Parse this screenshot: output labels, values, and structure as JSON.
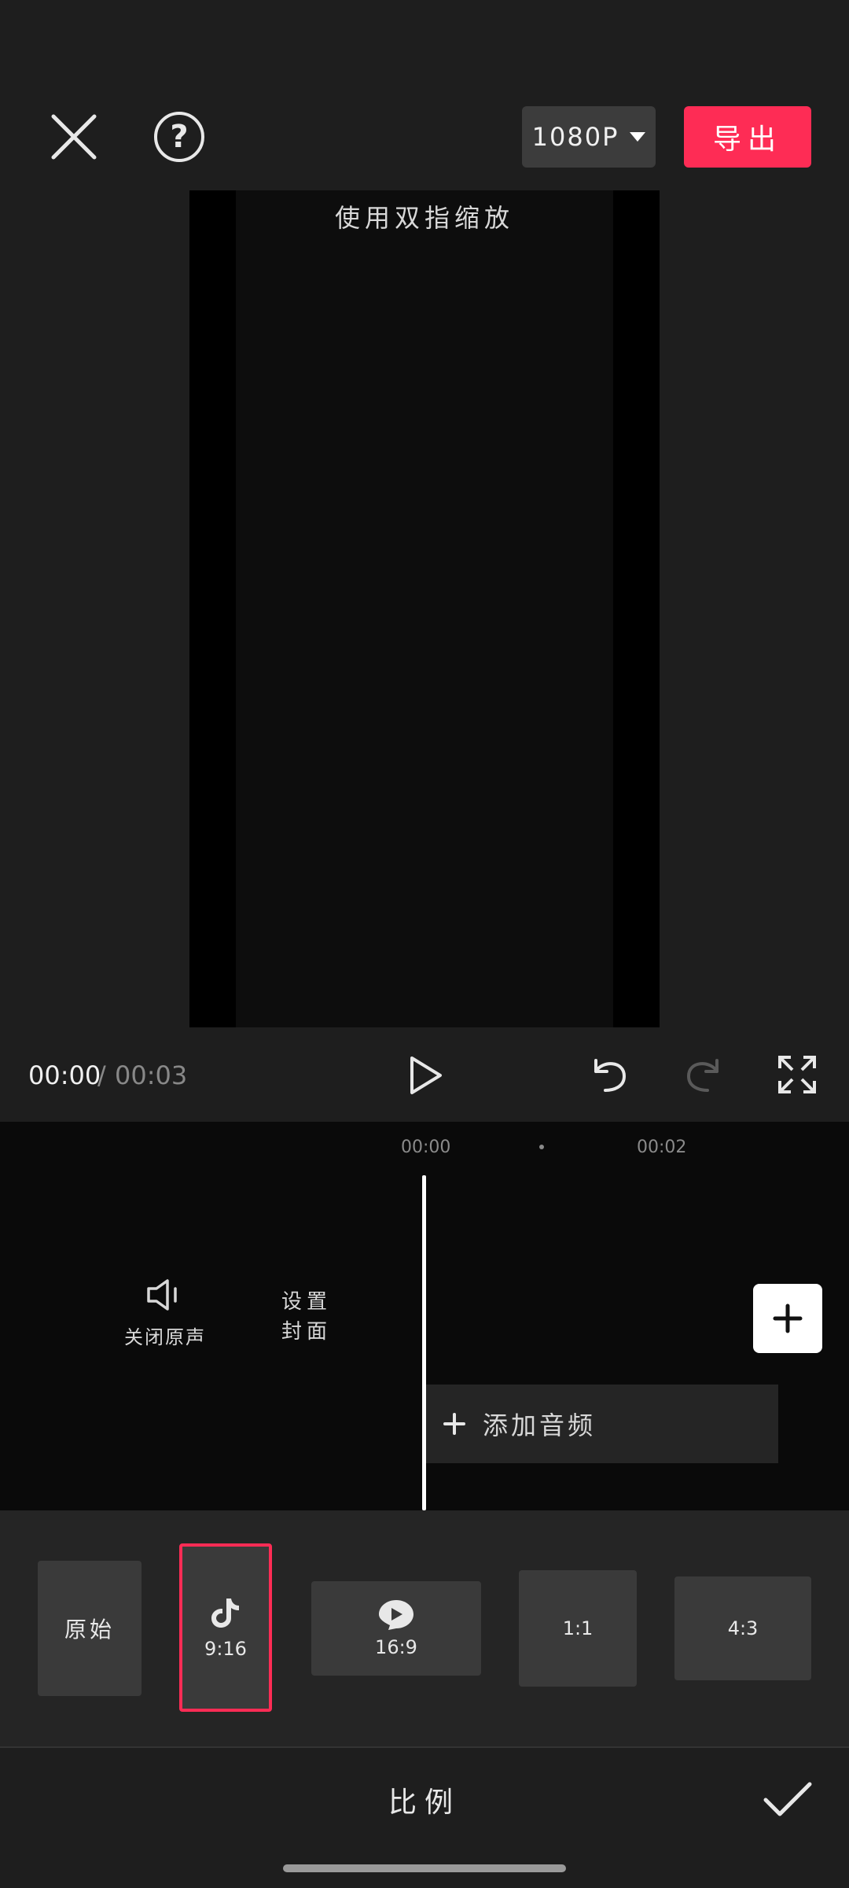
{
  "top_bar": {
    "resolution": "1080P",
    "export_label": "导出",
    "accent_color": "#fe2c55"
  },
  "preview": {
    "hint": "使用双指缩放"
  },
  "playback": {
    "current_time": "00:00",
    "separator": "/",
    "total_time": "00:03"
  },
  "timeline": {
    "ticks": [
      "00:00",
      "00:02"
    ],
    "mute_label": "关闭原声",
    "cover_label_line1": "设置",
    "cover_label_line2": "封面",
    "add_audio_label": "添加音频"
  },
  "ratio_options": [
    {
      "label": "原始"
    },
    {
      "label": "9:16",
      "icon": "tiktok-icon",
      "selected": true
    },
    {
      "label": "16:9",
      "icon": "video-platform-icon"
    },
    {
      "label": "1:1"
    },
    {
      "label": "4:3"
    }
  ],
  "bottom_bar": {
    "title": "比例"
  }
}
